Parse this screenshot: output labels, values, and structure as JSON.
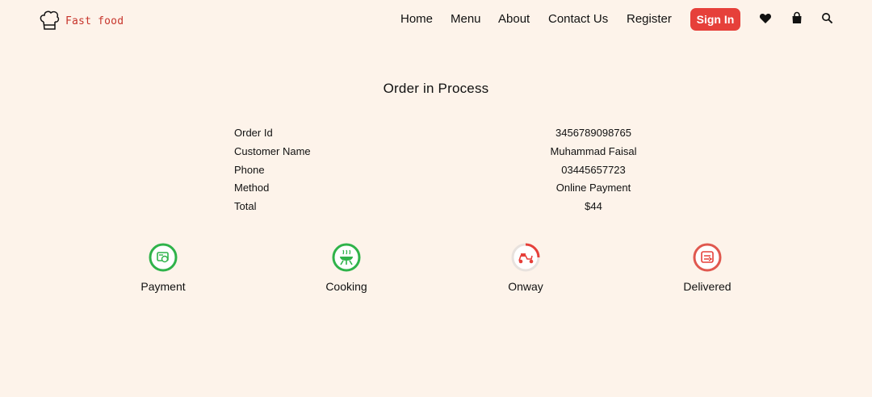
{
  "brand": {
    "name": "Fast food"
  },
  "nav": {
    "links": [
      "Home",
      "Menu",
      "About",
      "Contact Us",
      "Register"
    ],
    "signin_label": "Sign In",
    "icons": [
      "heart-icon",
      "shopping-bag-icon",
      "search-icon"
    ]
  },
  "order": {
    "title": "Order in Process",
    "rows": [
      {
        "label": "Order Id",
        "value": "3456789098765"
      },
      {
        "label": "Customer Name",
        "value": "Muhammad Faisal"
      },
      {
        "label": "Phone",
        "value": "03445657723"
      },
      {
        "label": "Method",
        "value": "Online Payment"
      },
      {
        "label": "Total",
        "value": "$44"
      }
    ]
  },
  "progress": {
    "steps": [
      {
        "label": "Payment",
        "status": "done",
        "icon": "payment-icon"
      },
      {
        "label": "Cooking",
        "status": "done",
        "icon": "cooking-icon"
      },
      {
        "label": "Onway",
        "status": "in-progress",
        "icon": "scooter-icon"
      },
      {
        "label": "Delivered",
        "status": "pending",
        "icon": "delivered-icon"
      }
    ]
  },
  "colors": {
    "background": "#fdf3ea",
    "accent": "#e6403a",
    "done": "#2fb34a"
  }
}
